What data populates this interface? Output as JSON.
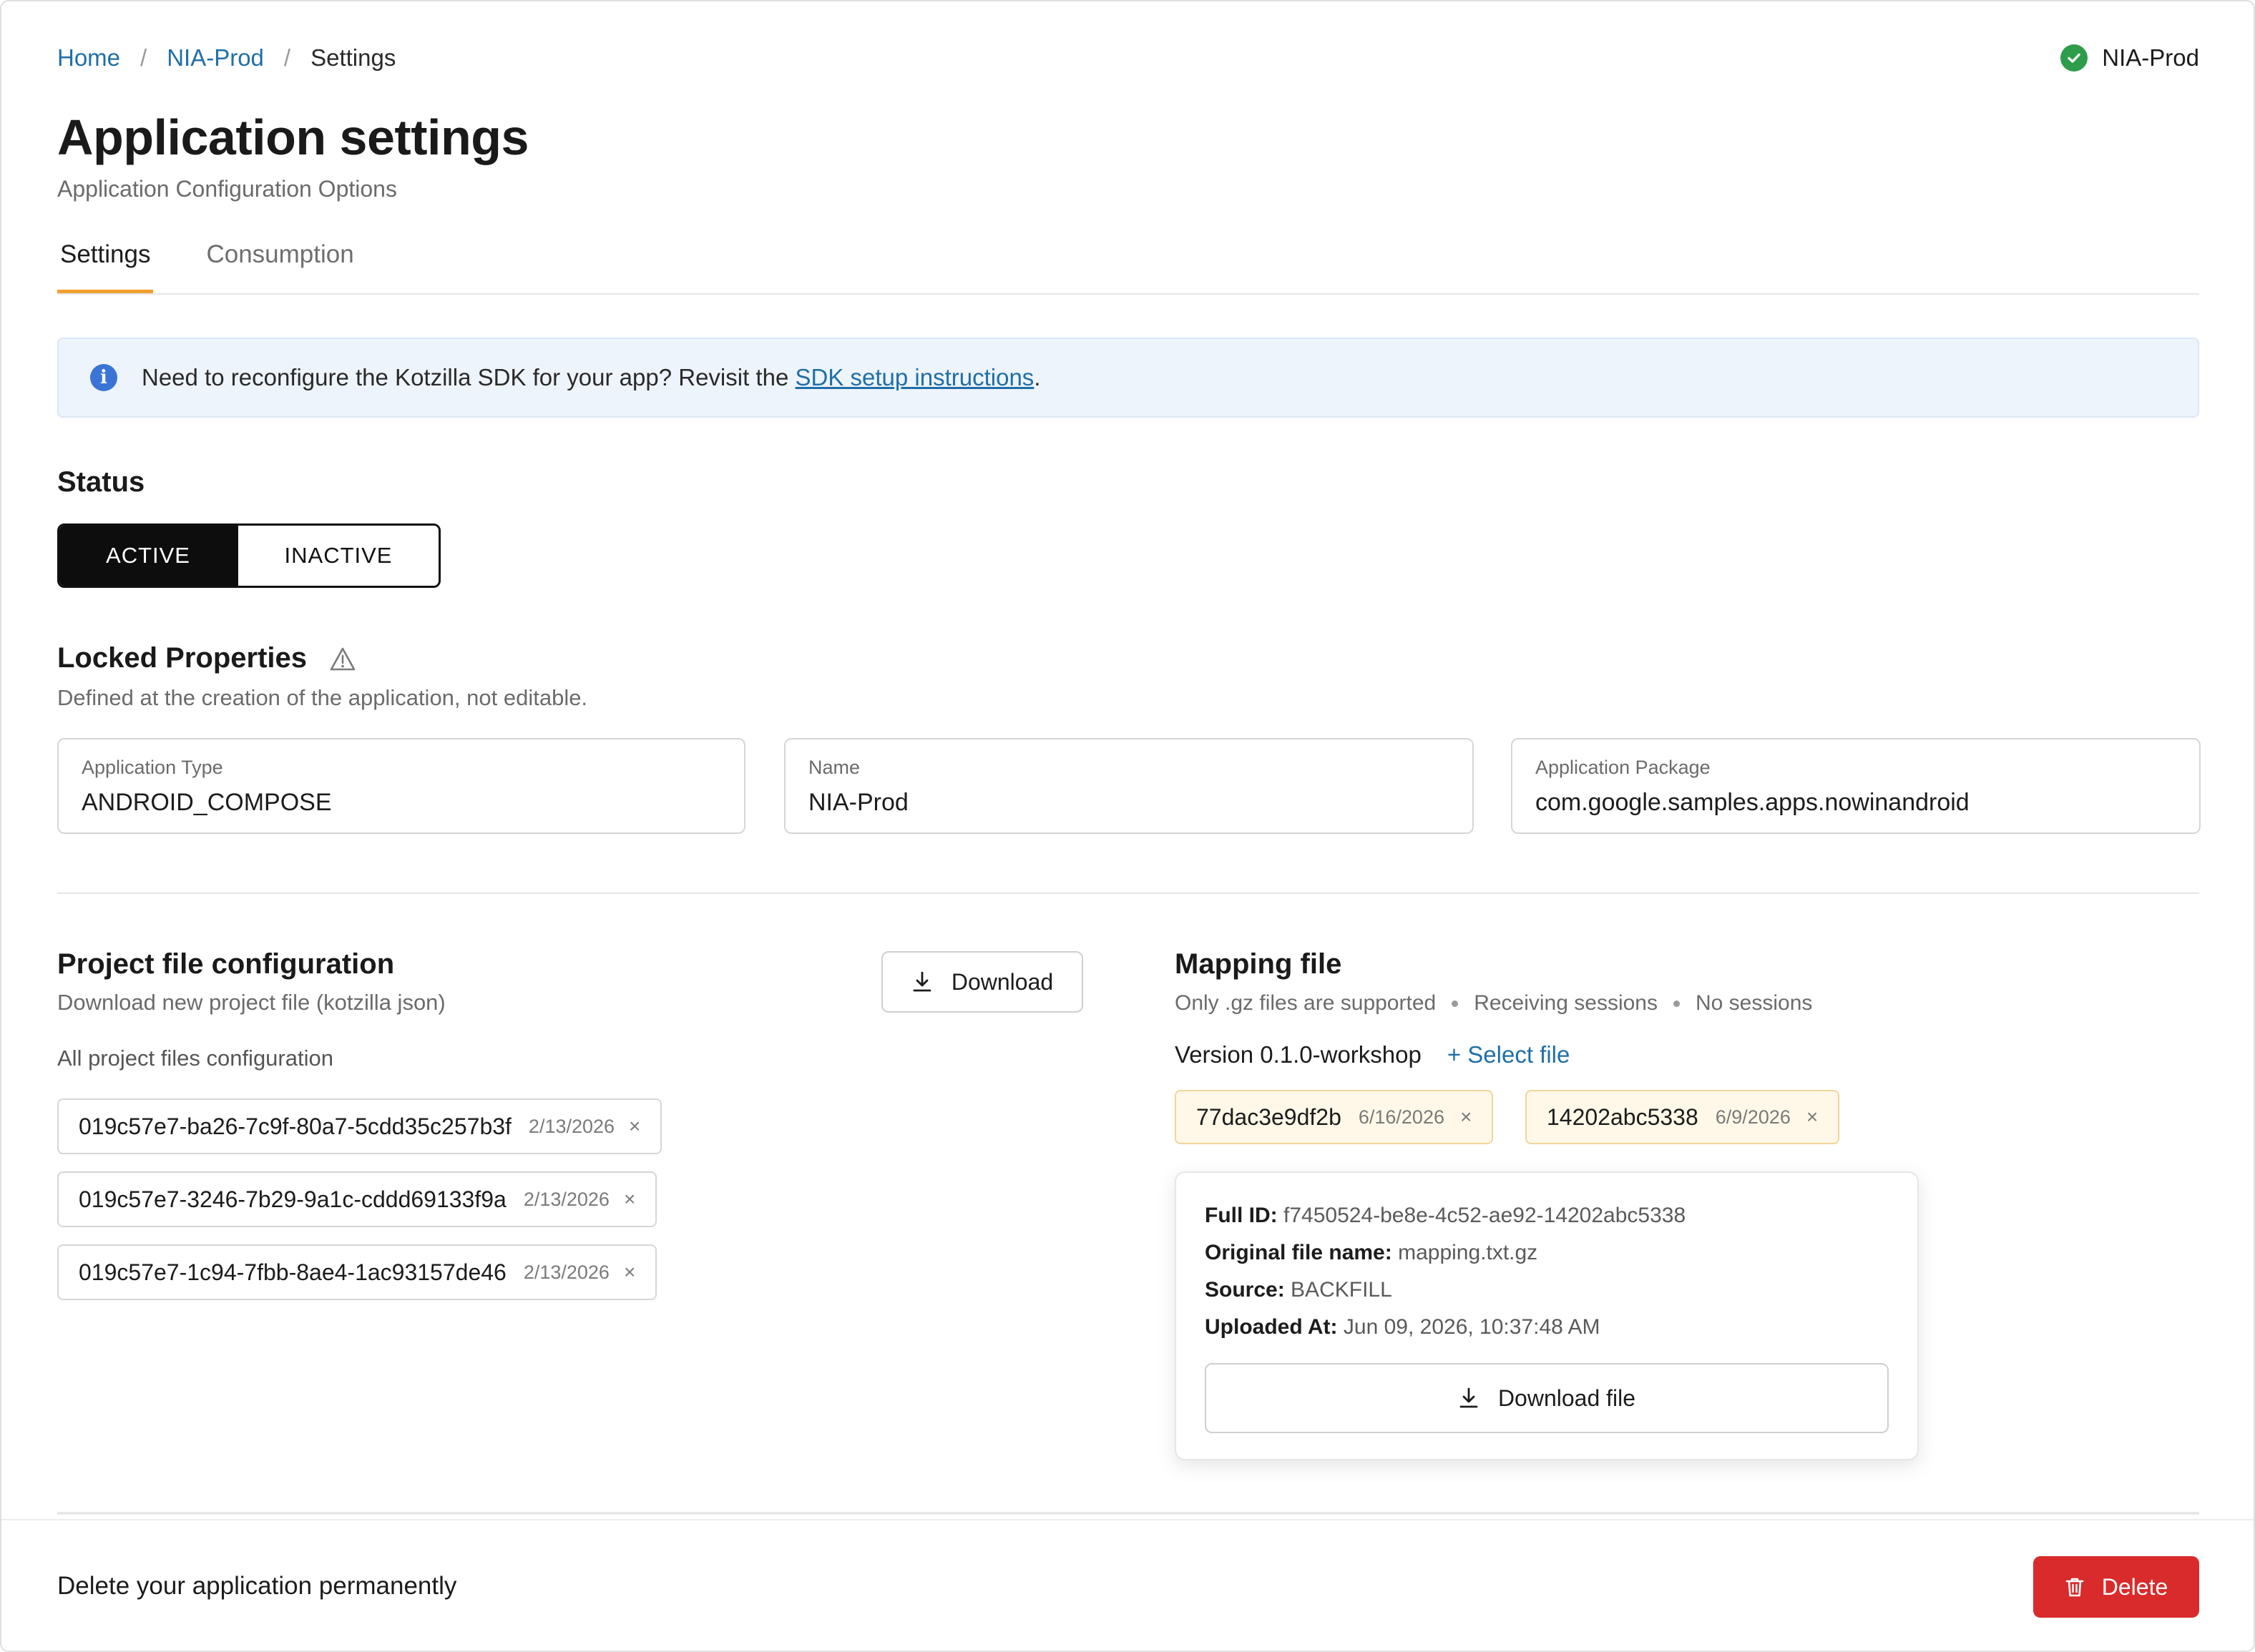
{
  "breadcrumb": {
    "home": "Home",
    "app": "NIA-Prod",
    "current": "Settings",
    "separator": "/"
  },
  "env_badge": {
    "label": "NIA-Prod",
    "status_color": "#2e9d4b"
  },
  "header": {
    "title": "Application settings",
    "subtitle": "Application Configuration Options"
  },
  "tabs": [
    {
      "label": "Settings",
      "active": true
    },
    {
      "label": "Consumption",
      "active": false
    }
  ],
  "banner": {
    "text_before": "Need to reconfigure the Kotzilla SDK for your app? Revisit the ",
    "link": "SDK setup instructions",
    "text_after": "."
  },
  "status": {
    "heading": "Status",
    "active_label": "ACTIVE",
    "inactive_label": "INACTIVE",
    "selected": "ACTIVE"
  },
  "locked": {
    "heading": "Locked Properties",
    "description": "Defined at the creation of the application, not editable.",
    "fields": [
      {
        "label": "Application Type",
        "value": "ANDROID_COMPOSE"
      },
      {
        "label": "Name",
        "value": "NIA-Prod"
      },
      {
        "label": "Application Package",
        "value": "com.google.samples.apps.nowinandroid"
      }
    ]
  },
  "project_config": {
    "heading": "Project file configuration",
    "description": "Download new project file (kotzilla json)",
    "download_label": "Download",
    "list_label": "All project files configuration",
    "files": [
      {
        "id": "019c57e7-ba26-7c9f-80a7-5cdd35c257b3f",
        "date": "2/13/2026"
      },
      {
        "id": "019c57e7-3246-7b29-9a1c-cddd69133f9a",
        "date": "2/13/2026"
      },
      {
        "id": "019c57e7-1c94-7fbb-8ae4-1ac93157de46",
        "date": "2/13/2026"
      }
    ]
  },
  "mapping": {
    "heading": "Mapping file",
    "meta": [
      "Only .gz files are supported",
      "Receiving sessions",
      "No sessions"
    ],
    "version": "Version 0.1.0-workshop",
    "select_label": "+ Select file",
    "files": [
      {
        "id": "77dac3e9df2b",
        "date": "6/16/2026"
      },
      {
        "id": "14202abc5338",
        "date": "6/9/2026"
      }
    ],
    "popover": {
      "full_id_label": "Full ID:",
      "full_id": "f7450524-be8e-4c52-ae92-14202abc5338",
      "original_name_label": "Original file name:",
      "original_name": "mapping.txt.gz",
      "source_label": "Source:",
      "source": "BACKFILL",
      "uploaded_label": "Uploaded At:",
      "uploaded": "Jun 09, 2026, 10:37:48 AM",
      "download_label": "Download file"
    }
  },
  "footer": {
    "text": "Delete your application permanently",
    "delete_label": "Delete",
    "delete_color": "#d92b2b"
  },
  "close_glyph": "×"
}
